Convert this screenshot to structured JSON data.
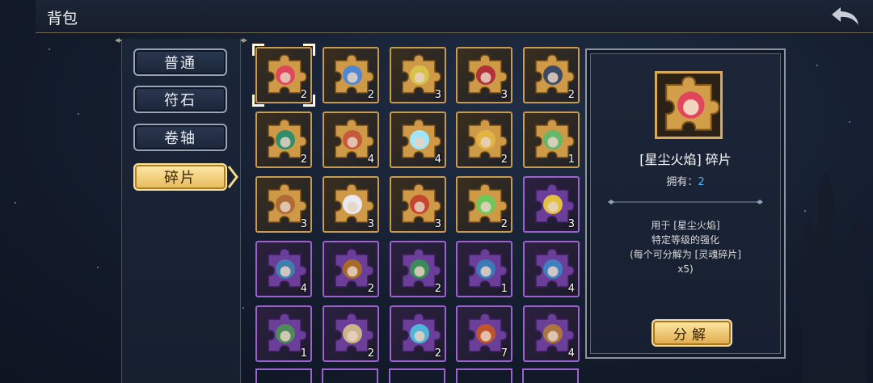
{
  "header": {
    "title": "背包"
  },
  "tabs": [
    {
      "label": "普通",
      "active": false
    },
    {
      "label": "符石",
      "active": false
    },
    {
      "label": "卷轴",
      "active": false
    },
    {
      "label": "碎片",
      "active": true
    }
  ],
  "grid": {
    "items": [
      {
        "count": "2",
        "rarity": "gold",
        "hue": "#e0475c",
        "selected": true
      },
      {
        "count": "2",
        "rarity": "gold",
        "hue": "#4f86d6"
      },
      {
        "count": "3",
        "rarity": "gold",
        "hue": "#d8c24a"
      },
      {
        "count": "3",
        "rarity": "gold",
        "hue": "#b2303a"
      },
      {
        "count": "2",
        "rarity": "gold",
        "hue": "#3b4a66"
      },
      {
        "count": "2",
        "rarity": "gold",
        "hue": "#2f8f6a"
      },
      {
        "count": "4",
        "rarity": "gold",
        "hue": "#c7583a"
      },
      {
        "count": "4",
        "rarity": "gold",
        "hue": "#9fe6ff"
      },
      {
        "count": "2",
        "rarity": "gold",
        "hue": "#e2b340"
      },
      {
        "count": "1",
        "rarity": "gold",
        "hue": "#64b86a"
      },
      {
        "count": "3",
        "rarity": "gold",
        "hue": "#b06a36"
      },
      {
        "count": "3",
        "rarity": "gold",
        "hue": "#e9e9ef"
      },
      {
        "count": "3",
        "rarity": "gold",
        "hue": "#c4462e"
      },
      {
        "count": "2",
        "rarity": "gold",
        "hue": "#6dc85a"
      },
      {
        "count": "3",
        "rarity": "purple",
        "hue": "#e2c040"
      },
      {
        "count": "4",
        "rarity": "purple",
        "hue": "#3e7fb0"
      },
      {
        "count": "2",
        "rarity": "purple",
        "hue": "#a86a2a"
      },
      {
        "count": "2",
        "rarity": "purple",
        "hue": "#3a8a5a"
      },
      {
        "count": "1",
        "rarity": "purple",
        "hue": "#3a7ab8"
      },
      {
        "count": "4",
        "rarity": "purple",
        "hue": "#3f7fc2"
      },
      {
        "count": "1",
        "rarity": "purple",
        "hue": "#4f8a5a"
      },
      {
        "count": "2",
        "rarity": "purple",
        "hue": "#cdb58a"
      },
      {
        "count": "2",
        "rarity": "purple",
        "hue": "#4fb6d6"
      },
      {
        "count": "7",
        "rarity": "purple",
        "hue": "#c0542a"
      },
      {
        "count": "4",
        "rarity": "purple",
        "hue": "#a8763e"
      }
    ]
  },
  "detail": {
    "name": "[星尘火焰] 碎片",
    "owned_label": "拥有：",
    "owned_value": "2",
    "desc_lines": [
      "用于 [星尘火焰]",
      "特定等级的强化",
      "(每个可分解为 [灵魂碎片]",
      "x5)"
    ],
    "decompose_label": "分解"
  },
  "colors": {
    "gold_border": "#c89a52",
    "purple_border": "#9b62d0",
    "accent_blue": "#4cb9ff"
  }
}
